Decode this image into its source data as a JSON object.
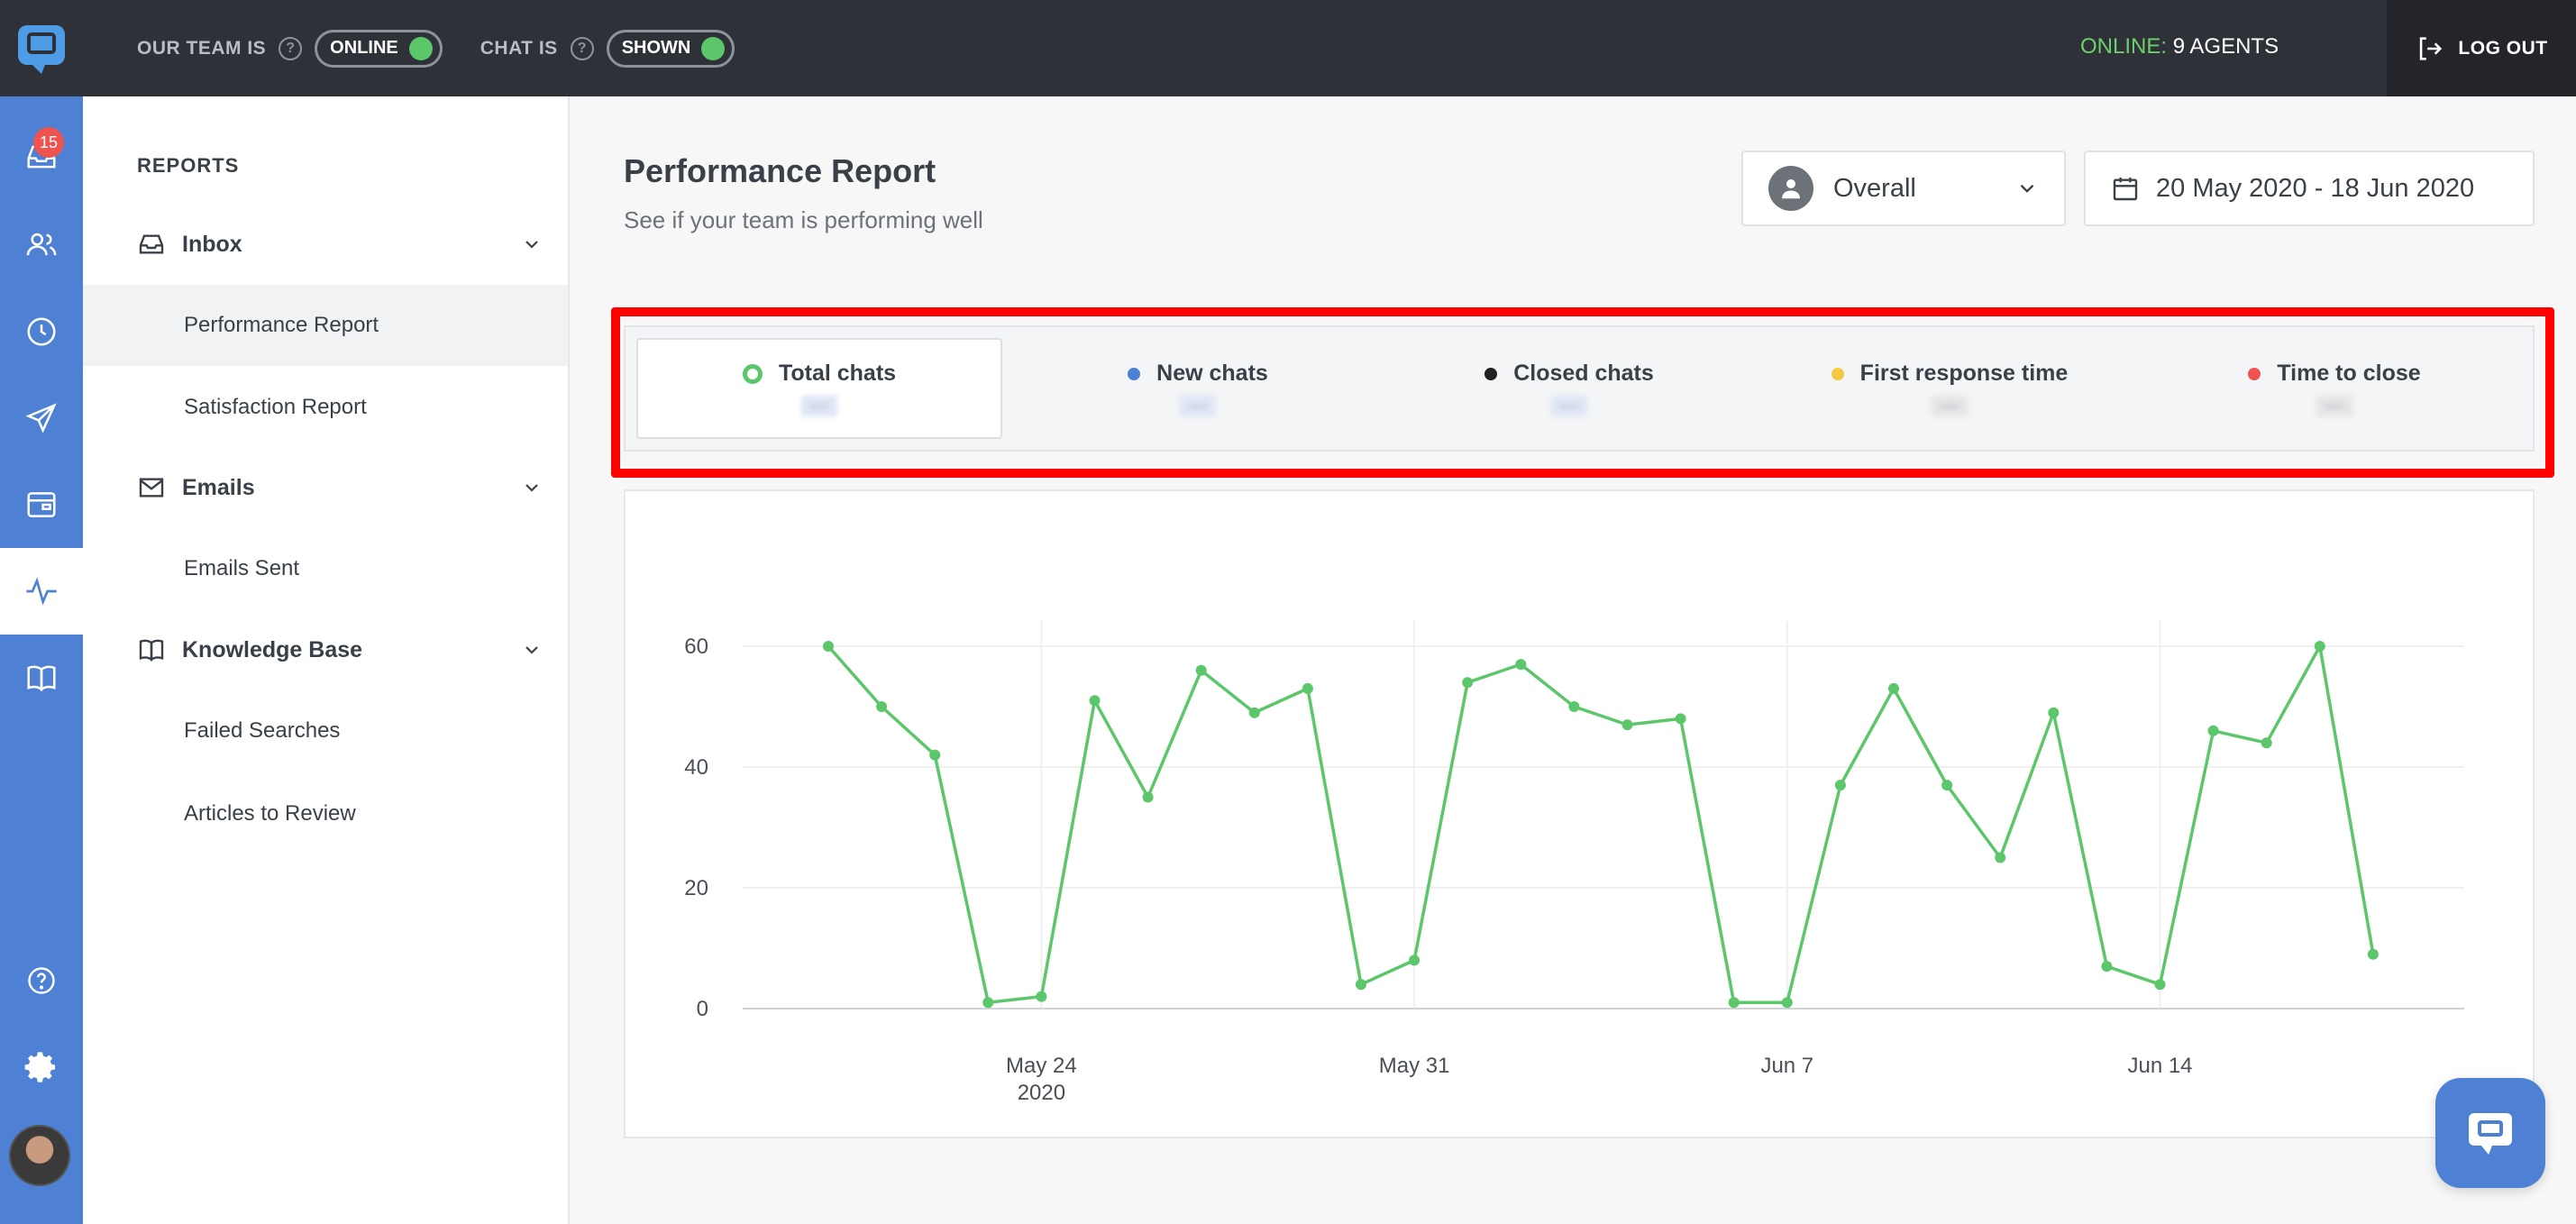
{
  "topbar": {
    "team_label": "OUR TEAM IS",
    "team_status": "ONLINE",
    "chat_label": "CHAT IS",
    "chat_status": "SHOWN",
    "online_word": "ONLINE:",
    "online_agents": "9 AGENTS",
    "logout_label": "LOG OUT"
  },
  "rail": {
    "badge_count": "15",
    "icons": [
      "inbox-icon",
      "users-icon",
      "history-icon",
      "send-icon",
      "wallet-icon",
      "reports-icon",
      "book-icon",
      "help-icon",
      "gear-icon"
    ]
  },
  "sidebar": {
    "heading": "REPORTS",
    "sections": [
      {
        "label": "Inbox",
        "items": [
          "Performance Report",
          "Satisfaction Report"
        ]
      },
      {
        "label": "Emails",
        "items": [
          "Emails Sent"
        ]
      },
      {
        "label": "Knowledge Base",
        "items": [
          "Failed Searches",
          "Articles to Review"
        ]
      }
    ]
  },
  "main": {
    "title": "Performance Report",
    "subtitle": "See if your team is performing well",
    "agent_filter": "Overall",
    "date_range": "20 May 2020 - 18 Jun 2020",
    "metrics": [
      {
        "label": "Total chats",
        "color": "#5cc66a",
        "value": "—"
      },
      {
        "label": "New chats",
        "color": "#4e80d4",
        "value": "—"
      },
      {
        "label": "Closed chats",
        "color": "#222222",
        "value": "—"
      },
      {
        "label": "First response time",
        "color": "#f5c842",
        "value": "—"
      },
      {
        "label": "Time to close",
        "color": "#ef5350",
        "value": "—"
      }
    ]
  },
  "chart_data": {
    "type": "line",
    "series": [
      {
        "color": "#5cc66a",
        "x": [
          "2020-05-20",
          "2020-05-21",
          "2020-05-22",
          "2020-05-23",
          "2020-05-24",
          "2020-05-25",
          "2020-05-26",
          "2020-05-27",
          "2020-05-28",
          "2020-05-29",
          "2020-05-30",
          "2020-05-31",
          "2020-06-01",
          "2020-06-02",
          "2020-06-03",
          "2020-06-04",
          "2020-06-05",
          "2020-06-06",
          "2020-06-07",
          "2020-06-08",
          "2020-06-09",
          "2020-06-10",
          "2020-06-11",
          "2020-06-12",
          "2020-06-13",
          "2020-06-14",
          "2020-06-15",
          "2020-06-16",
          "2020-06-17",
          "2020-06-18"
        ],
        "values": [
          60,
          50,
          42,
          1,
          2,
          51,
          35,
          56,
          49,
          53,
          4,
          8,
          54,
          57,
          50,
          47,
          48,
          1,
          1,
          37,
          53,
          37,
          25,
          49,
          7,
          4,
          46,
          44,
          60,
          9
        ]
      }
    ],
    "x_ticks": [
      {
        "label": "May 24",
        "sublabel": "2020"
      },
      {
        "label": "May 31",
        "sublabel": ""
      },
      {
        "label": "Jun 7",
        "sublabel": ""
      },
      {
        "label": "Jun 14",
        "sublabel": ""
      }
    ],
    "y_ticks": [
      "60",
      "40",
      "20",
      "0"
    ],
    "ylim": [
      0,
      60
    ],
    "grid": true
  }
}
